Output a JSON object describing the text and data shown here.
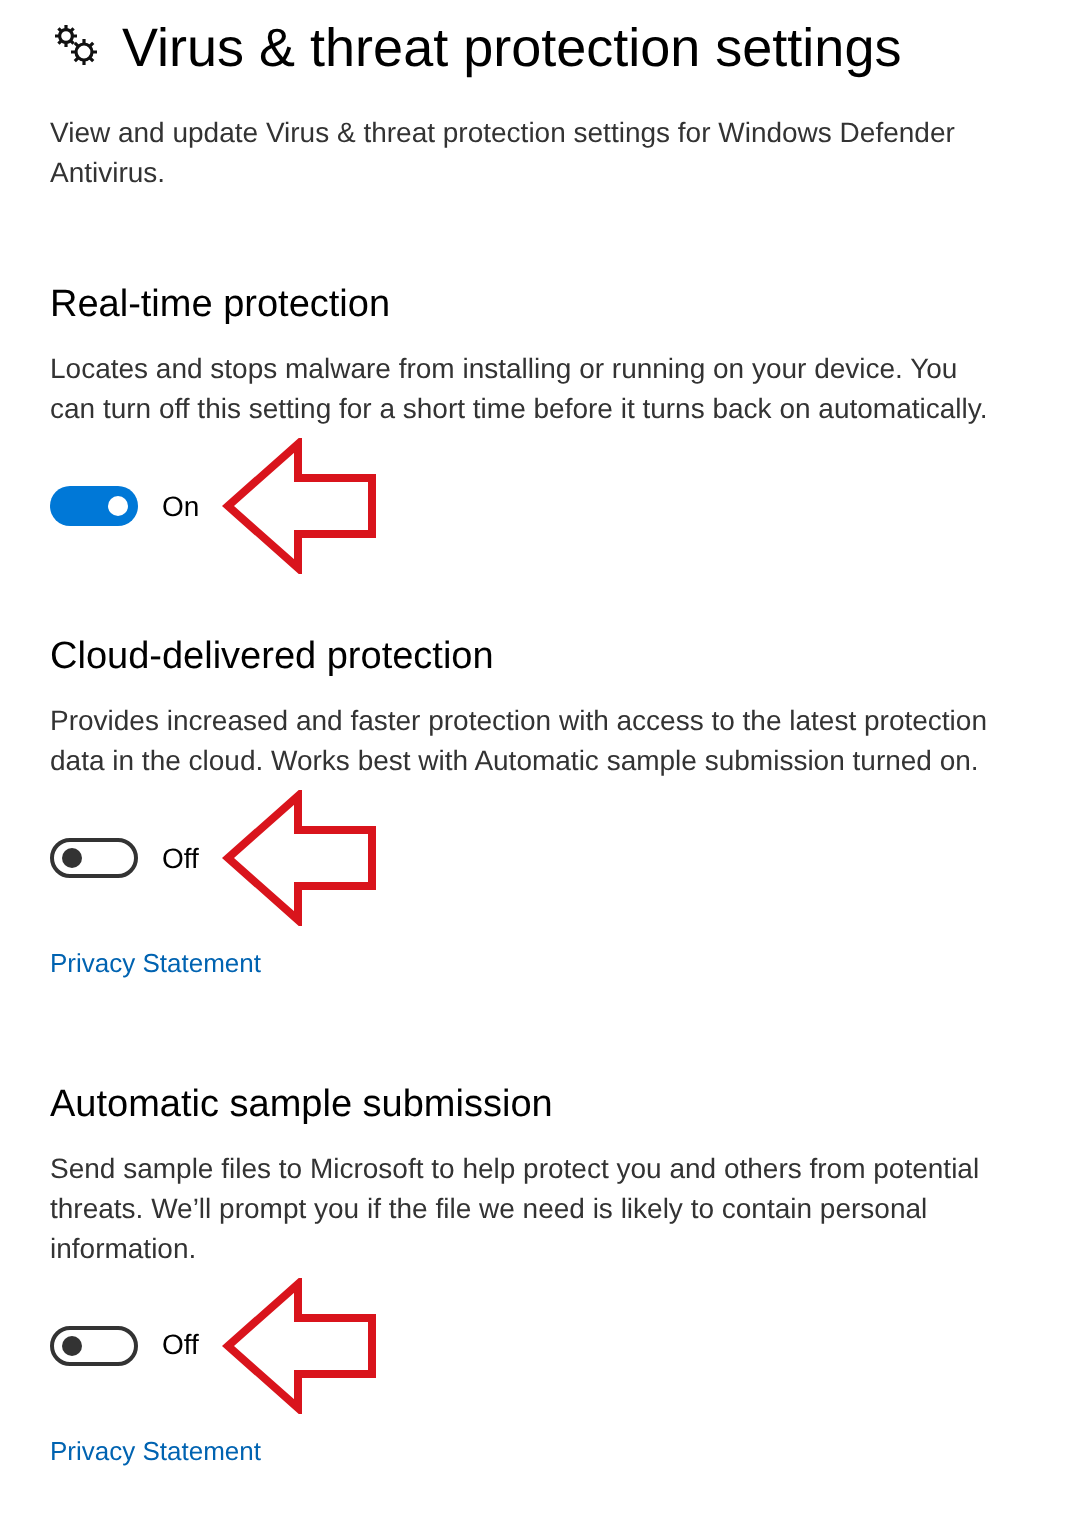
{
  "page": {
    "title": "Virus & threat protection settings",
    "description": "View and update Virus & threat protection settings for Windows Defender Antivirus."
  },
  "sections": [
    {
      "heading": "Real-time protection",
      "description": "Locates and stops malware from installing or running on your device. You can turn off this setting for a short time before it turns back on automatically.",
      "toggle": {
        "on": true,
        "label": "On"
      },
      "annotated": true
    },
    {
      "heading": "Cloud-delivered protection",
      "description": "Provides increased and faster protection with access to the latest protection data in the cloud.  Works best with Automatic sample submission turned on.",
      "toggle": {
        "on": false,
        "label": "Off"
      },
      "annotated": true,
      "link": "Privacy Statement"
    },
    {
      "heading": "Automatic sample submission",
      "description": "Send sample files to Microsoft to help protect you and others from potential threats.  We’ll prompt you if the file we need is likely to contain personal information.",
      "toggle": {
        "on": false,
        "label": "Off"
      },
      "annotated": true,
      "link": "Privacy Statement"
    }
  ]
}
